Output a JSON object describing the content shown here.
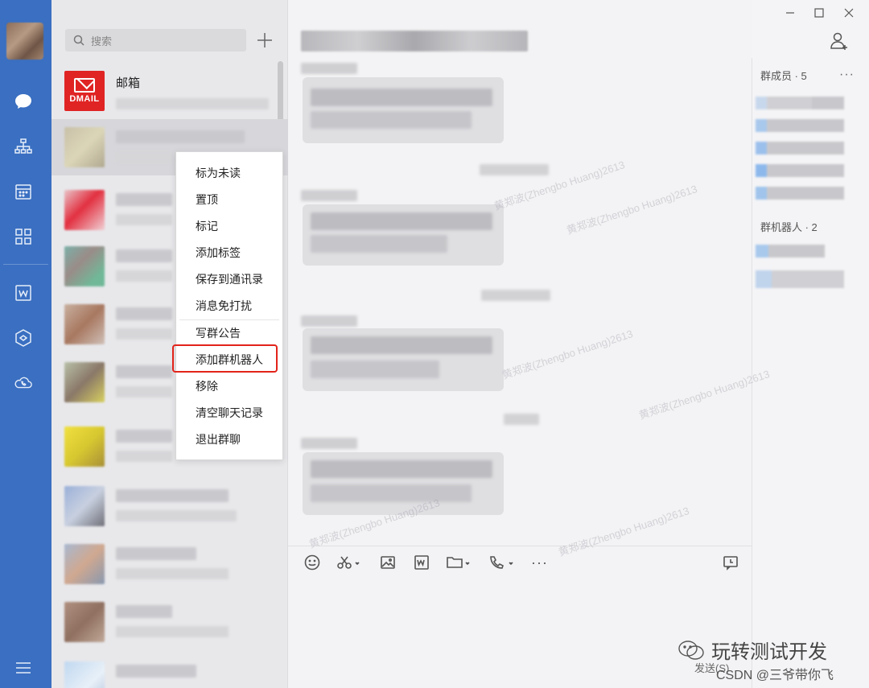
{
  "search": {
    "placeholder": "搜索"
  },
  "session_list": {
    "mail": {
      "name": "邮箱",
      "icon_text": "DMAIL"
    }
  },
  "context_menu": {
    "items": [
      "标为未读",
      "置顶",
      "标记",
      "添加标签",
      "保存到通讯录",
      "消息免打扰",
      "写群公告",
      "添加群机器人",
      "移除",
      "清空聊天记录",
      "退出群聊"
    ],
    "highlighted": "添加群机器人"
  },
  "right_panel": {
    "members_heading": "群成员 · 5",
    "bots_heading": "群机器人 · 2",
    "more": "···"
  },
  "toolbar": {
    "more": "···"
  },
  "send_hint": "发送(S)",
  "watermark": "黄郑波(Zhengbo Huang)2613",
  "footer": {
    "brand": "玩转测试开发",
    "csdn": "CSDN @三爷带你飞"
  },
  "colors": {
    "rail": "#3a6fc1",
    "highlight": "#e2231a",
    "mail_icon": "#e02424"
  }
}
